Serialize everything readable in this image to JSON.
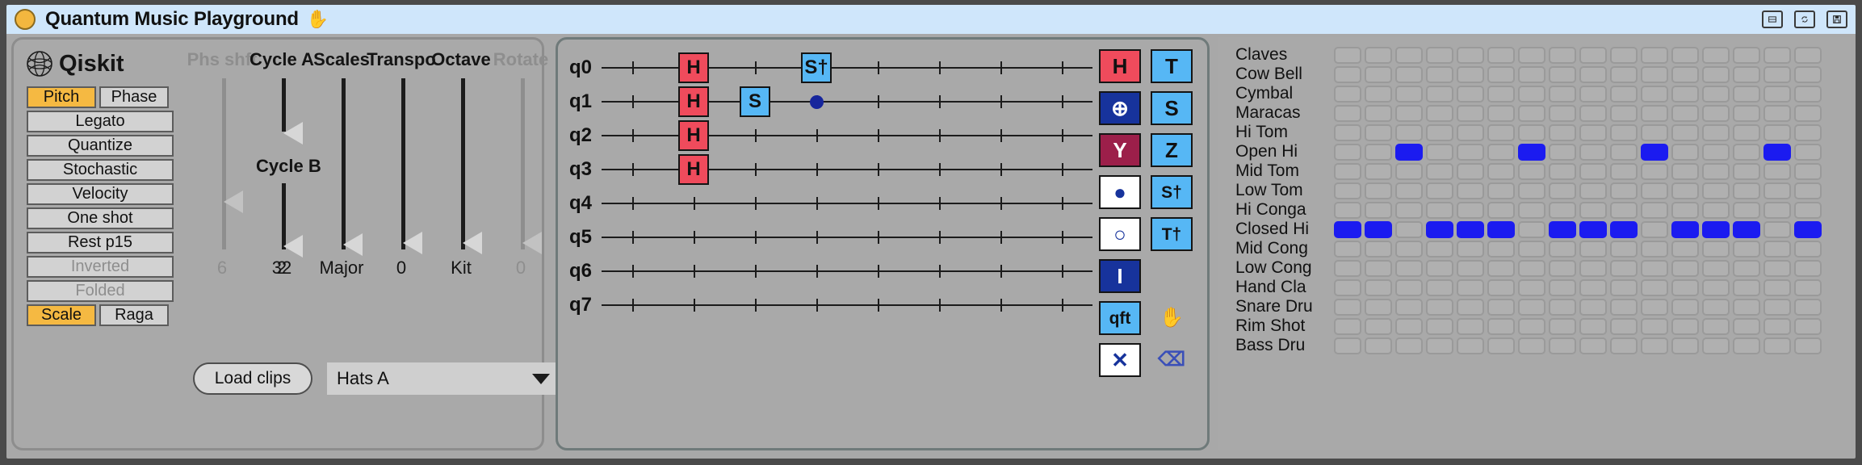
{
  "titlebar": {
    "app_title": "Quantum Music Playground",
    "hand_icon": "hand-icon",
    "buttons": [
      "window-icon",
      "reload-icon",
      "save-icon"
    ]
  },
  "left_panel": {
    "brand": "Qiskit",
    "toggle_pair_top": [
      {
        "label": "Pitch",
        "active": true
      },
      {
        "label": "Phase",
        "active": false
      }
    ],
    "buttons": [
      {
        "label": "Legato",
        "disabled": false
      },
      {
        "label": "Quantize",
        "disabled": false
      },
      {
        "label": "Stochastic",
        "disabled": false
      },
      {
        "label": "Velocity",
        "disabled": false
      },
      {
        "label": "One shot",
        "disabled": false
      },
      {
        "label": "Rest p15",
        "disabled": false
      },
      {
        "label": "Inverted",
        "disabled": true
      },
      {
        "label": "Folded",
        "disabled": true
      }
    ],
    "toggle_pair_bottom": [
      {
        "label": "Scale",
        "active": true
      },
      {
        "label": "Raga",
        "active": false
      }
    ],
    "sliders": [
      {
        "name": "Phs shft",
        "value": "6",
        "disabled": true,
        "knob_pct": 72
      },
      {
        "name": "Cycle A",
        "value": "2",
        "disabled": false,
        "knob_pct": 32
      },
      {
        "name": "Cycle B",
        "value": "32",
        "disabled": false,
        "knob_pct": 98
      },
      {
        "name": "Scales",
        "value": "Major",
        "disabled": false,
        "knob_pct": 97
      },
      {
        "name": "Transpo",
        "value": "0",
        "disabled": false,
        "knob_pct": 96
      },
      {
        "name": "Octave",
        "value": "Kit",
        "disabled": false,
        "knob_pct": 96
      },
      {
        "name": "Rotate",
        "value": "0",
        "disabled": true,
        "knob_pct": 96
      }
    ],
    "cycle_b_label": "Cycle B",
    "load_clips_label": "Load clips",
    "clip_select_value": "Hats A",
    "nav_buttons": [
      "<",
      "^",
      ">",
      "v"
    ]
  },
  "circuit": {
    "qubits": [
      "q0",
      "q1",
      "q2",
      "q3",
      "q4",
      "q5",
      "q6",
      "q7"
    ],
    "num_steps": 8,
    "gates": [
      {
        "qubit": 0,
        "step": 1,
        "label": "H",
        "kind": "h"
      },
      {
        "qubit": 0,
        "step": 3,
        "label": "S†",
        "kind": "s"
      },
      {
        "qubit": 1,
        "step": 1,
        "label": "H",
        "kind": "h"
      },
      {
        "qubit": 1,
        "step": 2,
        "label": "S",
        "kind": "s"
      },
      {
        "qubit": 2,
        "step": 1,
        "label": "H",
        "kind": "h"
      },
      {
        "qubit": 3,
        "step": 1,
        "label": "H",
        "kind": "h"
      }
    ],
    "control_dots": [
      {
        "qubit": 1,
        "step": 3
      }
    ],
    "palette": [
      {
        "label": "H",
        "style": "red",
        "name": "gate-h"
      },
      {
        "label": "T",
        "style": "lblue",
        "name": "gate-t"
      },
      {
        "label": "⊕",
        "style": "dblue",
        "name": "gate-cnot"
      },
      {
        "label": "S",
        "style": "lblue",
        "name": "gate-s"
      },
      {
        "label": "Y",
        "style": "maroon",
        "name": "gate-y"
      },
      {
        "label": "Z",
        "style": "lblue",
        "name": "gate-z"
      },
      {
        "label": "●",
        "style": "white",
        "name": "gate-control"
      },
      {
        "label": "S†",
        "style": "lblue",
        "name": "gate-s-dagger"
      },
      {
        "label": "○",
        "style": "white",
        "name": "gate-anticontrol"
      },
      {
        "label": "T†",
        "style": "lblue",
        "name": "gate-t-dagger"
      },
      {
        "label": "I",
        "style": "dblue",
        "name": "gate-identity"
      },
      {
        "label": "",
        "style": "empty",
        "name": "gate-empty"
      },
      {
        "label": "qft",
        "style": "lblue",
        "name": "gate-qft"
      },
      {
        "label": "✋",
        "style": "plain",
        "name": "hand-icon"
      },
      {
        "label": "✕",
        "style": "white",
        "name": "gate-swap"
      },
      {
        "label": "⌫",
        "style": "plain",
        "name": "erase-icon"
      }
    ]
  },
  "drum_grid": {
    "num_steps": 16,
    "rows": [
      {
        "label": "Claves",
        "steps": [
          0,
          0,
          0,
          0,
          0,
          0,
          0,
          0,
          0,
          0,
          0,
          0,
          0,
          0,
          0,
          0
        ]
      },
      {
        "label": "Cow Bell",
        "steps": [
          0,
          0,
          0,
          0,
          0,
          0,
          0,
          0,
          0,
          0,
          0,
          0,
          0,
          0,
          0,
          0
        ]
      },
      {
        "label": "Cymbal",
        "steps": [
          0,
          0,
          0,
          0,
          0,
          0,
          0,
          0,
          0,
          0,
          0,
          0,
          0,
          0,
          0,
          0
        ]
      },
      {
        "label": "Maracas",
        "steps": [
          0,
          0,
          0,
          0,
          0,
          0,
          0,
          0,
          0,
          0,
          0,
          0,
          0,
          0,
          0,
          0
        ]
      },
      {
        "label": "Hi Tom",
        "steps": [
          0,
          0,
          0,
          0,
          0,
          0,
          0,
          0,
          0,
          0,
          0,
          0,
          0,
          0,
          0,
          0
        ]
      },
      {
        "label": "Open Hi",
        "steps": [
          0,
          0,
          1,
          0,
          0,
          0,
          1,
          0,
          0,
          0,
          1,
          0,
          0,
          0,
          1,
          0
        ]
      },
      {
        "label": "Mid Tom",
        "steps": [
          0,
          0,
          0,
          0,
          0,
          0,
          0,
          0,
          0,
          0,
          0,
          0,
          0,
          0,
          0,
          0
        ]
      },
      {
        "label": "Low Tom",
        "steps": [
          0,
          0,
          0,
          0,
          0,
          0,
          0,
          0,
          0,
          0,
          0,
          0,
          0,
          0,
          0,
          0
        ]
      },
      {
        "label": "Hi Conga",
        "steps": [
          0,
          0,
          0,
          0,
          0,
          0,
          0,
          0,
          0,
          0,
          0,
          0,
          0,
          0,
          0,
          0
        ]
      },
      {
        "label": "Closed Hi",
        "steps": [
          1,
          1,
          0,
          1,
          1,
          1,
          0,
          1,
          1,
          1,
          0,
          1,
          1,
          1,
          0,
          1
        ]
      },
      {
        "label": "Mid Cong",
        "steps": [
          0,
          0,
          0,
          0,
          0,
          0,
          0,
          0,
          0,
          0,
          0,
          0,
          0,
          0,
          0,
          0
        ]
      },
      {
        "label": "Low Cong",
        "steps": [
          0,
          0,
          0,
          0,
          0,
          0,
          0,
          0,
          0,
          0,
          0,
          0,
          0,
          0,
          0,
          0
        ]
      },
      {
        "label": "Hand Cla",
        "steps": [
          0,
          0,
          0,
          0,
          0,
          0,
          0,
          0,
          0,
          0,
          0,
          0,
          0,
          0,
          0,
          0
        ]
      },
      {
        "label": "Snare Dru",
        "steps": [
          0,
          0,
          0,
          0,
          0,
          0,
          0,
          0,
          0,
          0,
          0,
          0,
          0,
          0,
          0,
          0
        ]
      },
      {
        "label": "Rim Shot",
        "steps": [
          0,
          0,
          0,
          0,
          0,
          0,
          0,
          0,
          0,
          0,
          0,
          0,
          0,
          0,
          0,
          0
        ]
      },
      {
        "label": "Bass Dru",
        "steps": [
          0,
          0,
          0,
          0,
          0,
          0,
          0,
          0,
          0,
          0,
          0,
          0,
          0,
          0,
          0,
          0
        ]
      }
    ]
  },
  "colors": {
    "titlebar_bg": "#cfe6fb",
    "panel_bg": "#a9a9a9",
    "accent_orange": "#f5b942",
    "gate_red": "#ef4b5c",
    "gate_blue": "#56b7f5",
    "gate_dark_blue": "#17339c",
    "gate_maroon": "#9c1f4a",
    "step_on": "#1b1bf0"
  }
}
